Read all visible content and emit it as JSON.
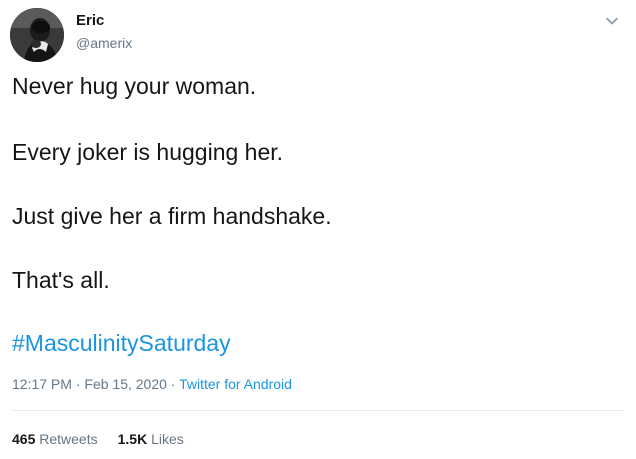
{
  "user": {
    "display_name": "Eric",
    "handle": "@amerix",
    "avatar_icon": "profile-photo"
  },
  "menu": {
    "icon": "chevron-down-icon"
  },
  "tweet": {
    "lines": [
      "Never hug your woman.",
      "Every joker is hugging her.",
      "Just give her a firm handshake.",
      "That's all."
    ],
    "hashtag": "#MasculinitySaturday"
  },
  "meta": {
    "time": "12:17 PM",
    "date": "Feb 15, 2020",
    "separator": "·",
    "source": "Twitter for Android"
  },
  "stats": {
    "retweets_count": "465",
    "retweets_label": "Retweets",
    "likes_count": "1.5K",
    "likes_label": "Likes"
  },
  "colors": {
    "link": "#1b95e0",
    "muted": "#657786",
    "text": "#14171a",
    "divider": "#e6ecf0"
  }
}
